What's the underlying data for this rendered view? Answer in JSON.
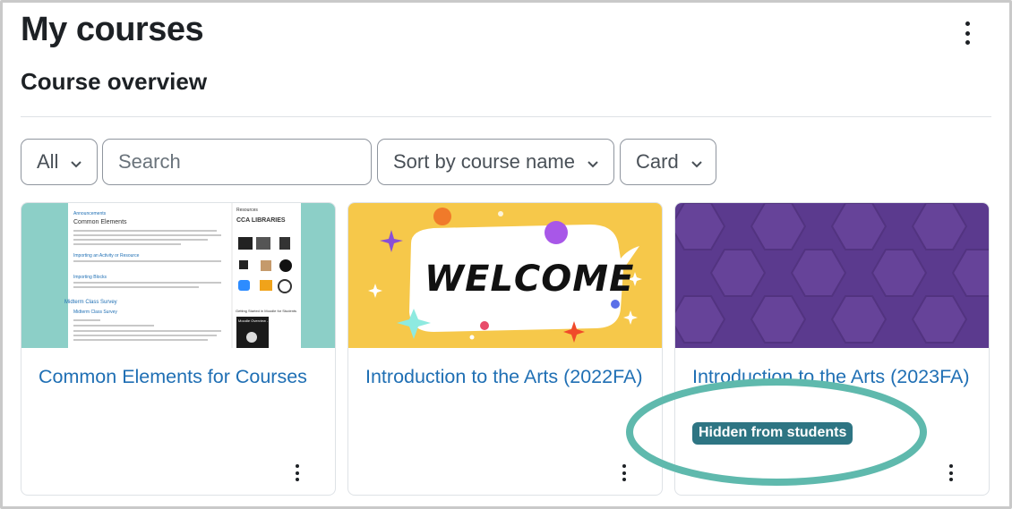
{
  "page": {
    "title": "My courses",
    "section_title": "Course overview"
  },
  "controls": {
    "grouping_label": "All",
    "search_placeholder": "Search",
    "sort_label": "Sort by course name",
    "view_label": "Card"
  },
  "thumb1": {
    "left_items": [
      "Announcements",
      "Common Elements",
      "Importing an Activity or Resource",
      "Importing Blocks",
      "Midterm Class Survey",
      "Midterm Class Survey"
    ],
    "resources_heading": "Resources",
    "library_text": "CCA LIBRARIES",
    "getting_started": "Getting Started in Moodle for Students",
    "video_title": "Moodle Overview - Students"
  },
  "thumb2": {
    "welcome": "WELCOME"
  },
  "courses": [
    {
      "name": "Common Elements for Courses"
    },
    {
      "name": "Introduction to the Arts (2022FA)"
    },
    {
      "name": "Introduction to the Arts (2023FA)",
      "badge": "Hidden from students"
    }
  ],
  "colors": {
    "link": "#1f6fb4",
    "badge": "#2e7583",
    "highlight": "#5fb9ad",
    "purple": "#5b3a8e"
  }
}
